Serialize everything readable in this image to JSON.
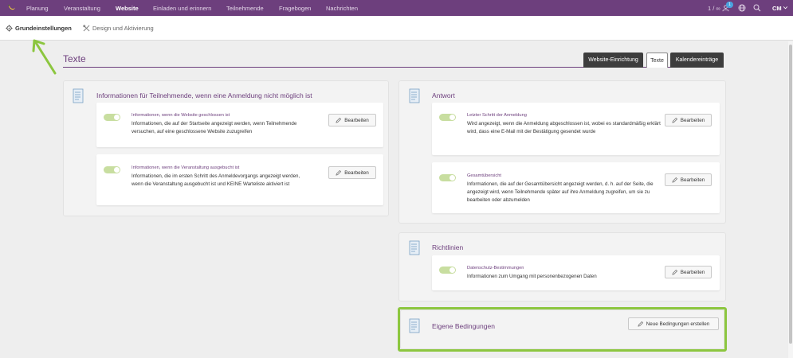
{
  "topnav": {
    "items": [
      "Planung",
      "Veranstaltung",
      "Website",
      "Einladen und erinnern",
      "Teilnehmende",
      "Fragebogen",
      "Nachrichten"
    ],
    "active": "Website",
    "quota": "1 / ∞",
    "notification_count": "1",
    "user_initials": "CM"
  },
  "subnav": {
    "items": [
      {
        "label": "Grundeinstellungen",
        "icon": "gear-icon",
        "active": true
      },
      {
        "label": "Design und Aktivierung",
        "icon": "palette-icon",
        "active": false
      }
    ]
  },
  "page": {
    "title": "Texte",
    "tabs": [
      "Website-Einrichtung",
      "Texte",
      "Kalendereinträge"
    ],
    "active_tab": "Texte"
  },
  "panels": {
    "left": {
      "title": "Informationen für Teilnehmende, wenn eine Anmeldung nicht möglich ist",
      "cards": [
        {
          "title": "Informationen, wenn die Website geschlossen ist",
          "desc": "Informationen, die auf der Startseite angezeigt werden, wenn Teilnehmende versuchen, auf eine geschlossene Website zuzugreifen",
          "button": "Bearbeiten"
        },
        {
          "title": "Informationen, wenn die Veranstaltung ausgebucht ist",
          "desc": "Informationen, die im ersten Schritt des Anmeldevorgangs angezeigt werden, wenn die Veranstaltung ausgebucht ist und KEINE Warteliste aktiviert ist",
          "button": "Bearbeiten"
        }
      ]
    },
    "antwort": {
      "title": "Antwort",
      "cards": [
        {
          "title": "Letzter Schritt der Anmeldung",
          "desc": "Wird angezeigt, wenn die Anmeldung abgeschlossen ist, wobei es standardmäßig erklärt wird, dass eine E-Mail mit der Bestätigung gesendet wurde",
          "button": "Bearbeiten"
        },
        {
          "title": "Gesamtübersicht",
          "desc": "Informationen, die auf der Gesamtübersicht angezeigt werden, d. h. auf der Seite, die angezeigt wird, wenn Teilnehmende später auf ihre Anmeldung zugreifen, um sie zu bearbeiten oder abzumelden",
          "button": "Bearbeiten"
        }
      ]
    },
    "richtlinien": {
      "title": "Richtlinien",
      "cards": [
        {
          "title": "Datenschutz-Bestimmungen",
          "desc": "Informationen zum Umgang mit personenbezogenen Daten",
          "button": "Bearbeiten"
        }
      ]
    },
    "eigene": {
      "title": "Eigene Bedingungen",
      "button": "Neue Bedingungen erstellen"
    }
  },
  "colors": {
    "brand": "#6d3f7d",
    "toggle_on": "#c8dea0",
    "highlight": "#8cc63f",
    "tab_dark": "#3d3d3d"
  }
}
